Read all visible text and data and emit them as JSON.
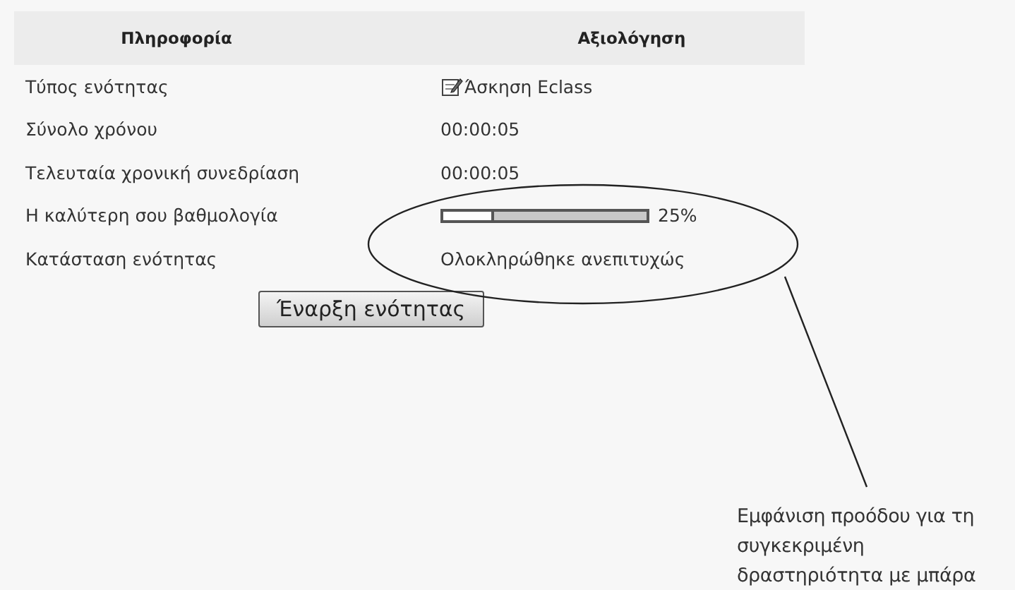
{
  "table": {
    "columns": [
      "Πληροφορία",
      "Αξιολόγηση"
    ],
    "rows": [
      {
        "kind": "type",
        "label": "Τύπος ενότητας",
        "value": "Άσκηση Eclass"
      },
      {
        "kind": "text",
        "label": "Σύνολο χρόνου",
        "value": "00:00:05"
      },
      {
        "kind": "text",
        "label": "Τελευταία χρονική συνεδρίαση",
        "value": "00:00:05"
      },
      {
        "kind": "progress",
        "label": "Η καλύτερη σου βαθμολογία",
        "level": 0.25,
        "reading": "25%"
      },
      {
        "kind": "text",
        "label": "Κατάσταση ενότητας",
        "value": "Ολοκληρώθηκε ανεπιτυχώς"
      }
    ]
  },
  "button": "Έναρξη ενότητας",
  "annotation": {
    "caption_lines": [
      "Εμφάνιση προόδου για τη",
      "συγκεκριμένη",
      "δραστηριότητα με μπάρα"
    ]
  }
}
